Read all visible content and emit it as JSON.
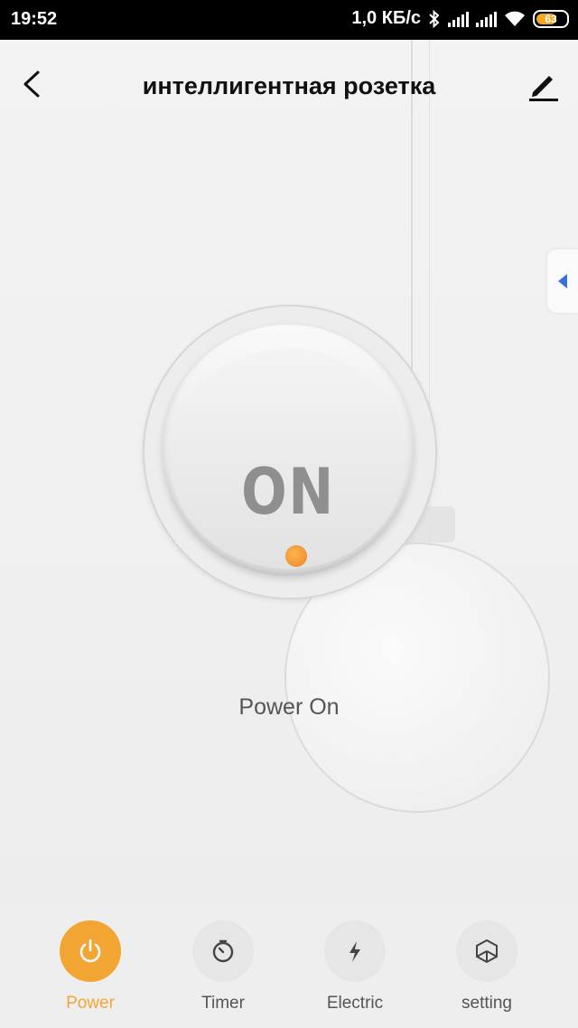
{
  "status_bar": {
    "time": "19:52",
    "network_speed": "1,0 КБ/с",
    "battery": "63"
  },
  "header": {
    "title": "интеллигентная розетка"
  },
  "power_button": {
    "label": "ON",
    "status_text": "Power On"
  },
  "bottom_nav": {
    "items": [
      {
        "label": "Power",
        "icon": "power-icon",
        "active": true
      },
      {
        "label": "Timer",
        "icon": "timer-icon",
        "active": false
      },
      {
        "label": "Electric",
        "icon": "lightning-icon",
        "active": false
      },
      {
        "label": "setting",
        "icon": "cube-icon",
        "active": false
      }
    ]
  },
  "colors": {
    "accent": "#f3a534",
    "side_tab_arrow": "#3b6fd9"
  }
}
